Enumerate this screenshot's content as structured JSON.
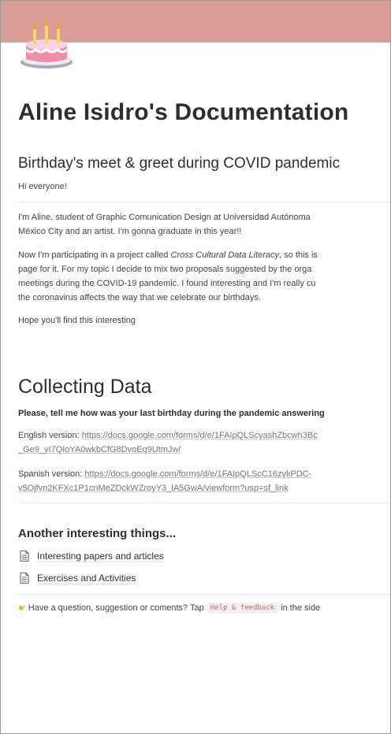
{
  "page": {
    "title": "Aline Isidro's Documentation",
    "cover_color": "#d99e96",
    "icon": "birthday-cake-icon"
  },
  "intro": {
    "heading": "Birthday's meet & greet during COVID pandemic",
    "greeting": "Hi everyone!",
    "p1_line1": "I'm Aline, student of Graphic Comunication Design at Universidad Autónoma",
    "p1_line2": "México City and an artist. I'm gonna graduate in this year!!",
    "p2_line1_a": "Now I'm participating in a project called ",
    "p2_line1_em": "Cross Cultural Data Literacy",
    "p2_line1_b": ", so this is",
    "p2_line2": "page for it. For my topic I decide to mix two proposals suggested by the orga",
    "p2_line3": "meetings during the COVID-19 pandemic. I found interesting and I'm really cu",
    "p2_line4": "the coronavirus affects the way that we celebrate our birthdays.",
    "p3": "Hope you'll find this interesting"
  },
  "collecting": {
    "heading": "Collecting Data",
    "prompt": "Please, tell me how was your last birthday  during the pandemic answering",
    "english_label": "English version: ",
    "english_link_1": "https://docs.google.com/forms/d/e/1FAIpQLScyashZbcwh3Bc",
    "english_link_2": "_Ge9_yI7QIoYA0wkbCfG8DvoEq9UtmJw/",
    "spanish_label": "Spanish version: ",
    "spanish_link_1": "https://docs.google.com/forms/d/e/1FAIpQLScC16zykPDC-",
    "spanish_link_2": "v5Ojfvn2KFXc1P1cnMeZDckWZroyY3_lA5GwA/viewform?usp=sf_link"
  },
  "other": {
    "heading": "Another interesting things...",
    "links": [
      "Interesting papers and articles",
      "Exercises and Activities"
    ]
  },
  "callout": {
    "icon": "pointing-hand-icon",
    "text_a": "Have a question, suggestion or coments? Tap",
    "code": "Help & feedback",
    "text_b": "in the side"
  }
}
